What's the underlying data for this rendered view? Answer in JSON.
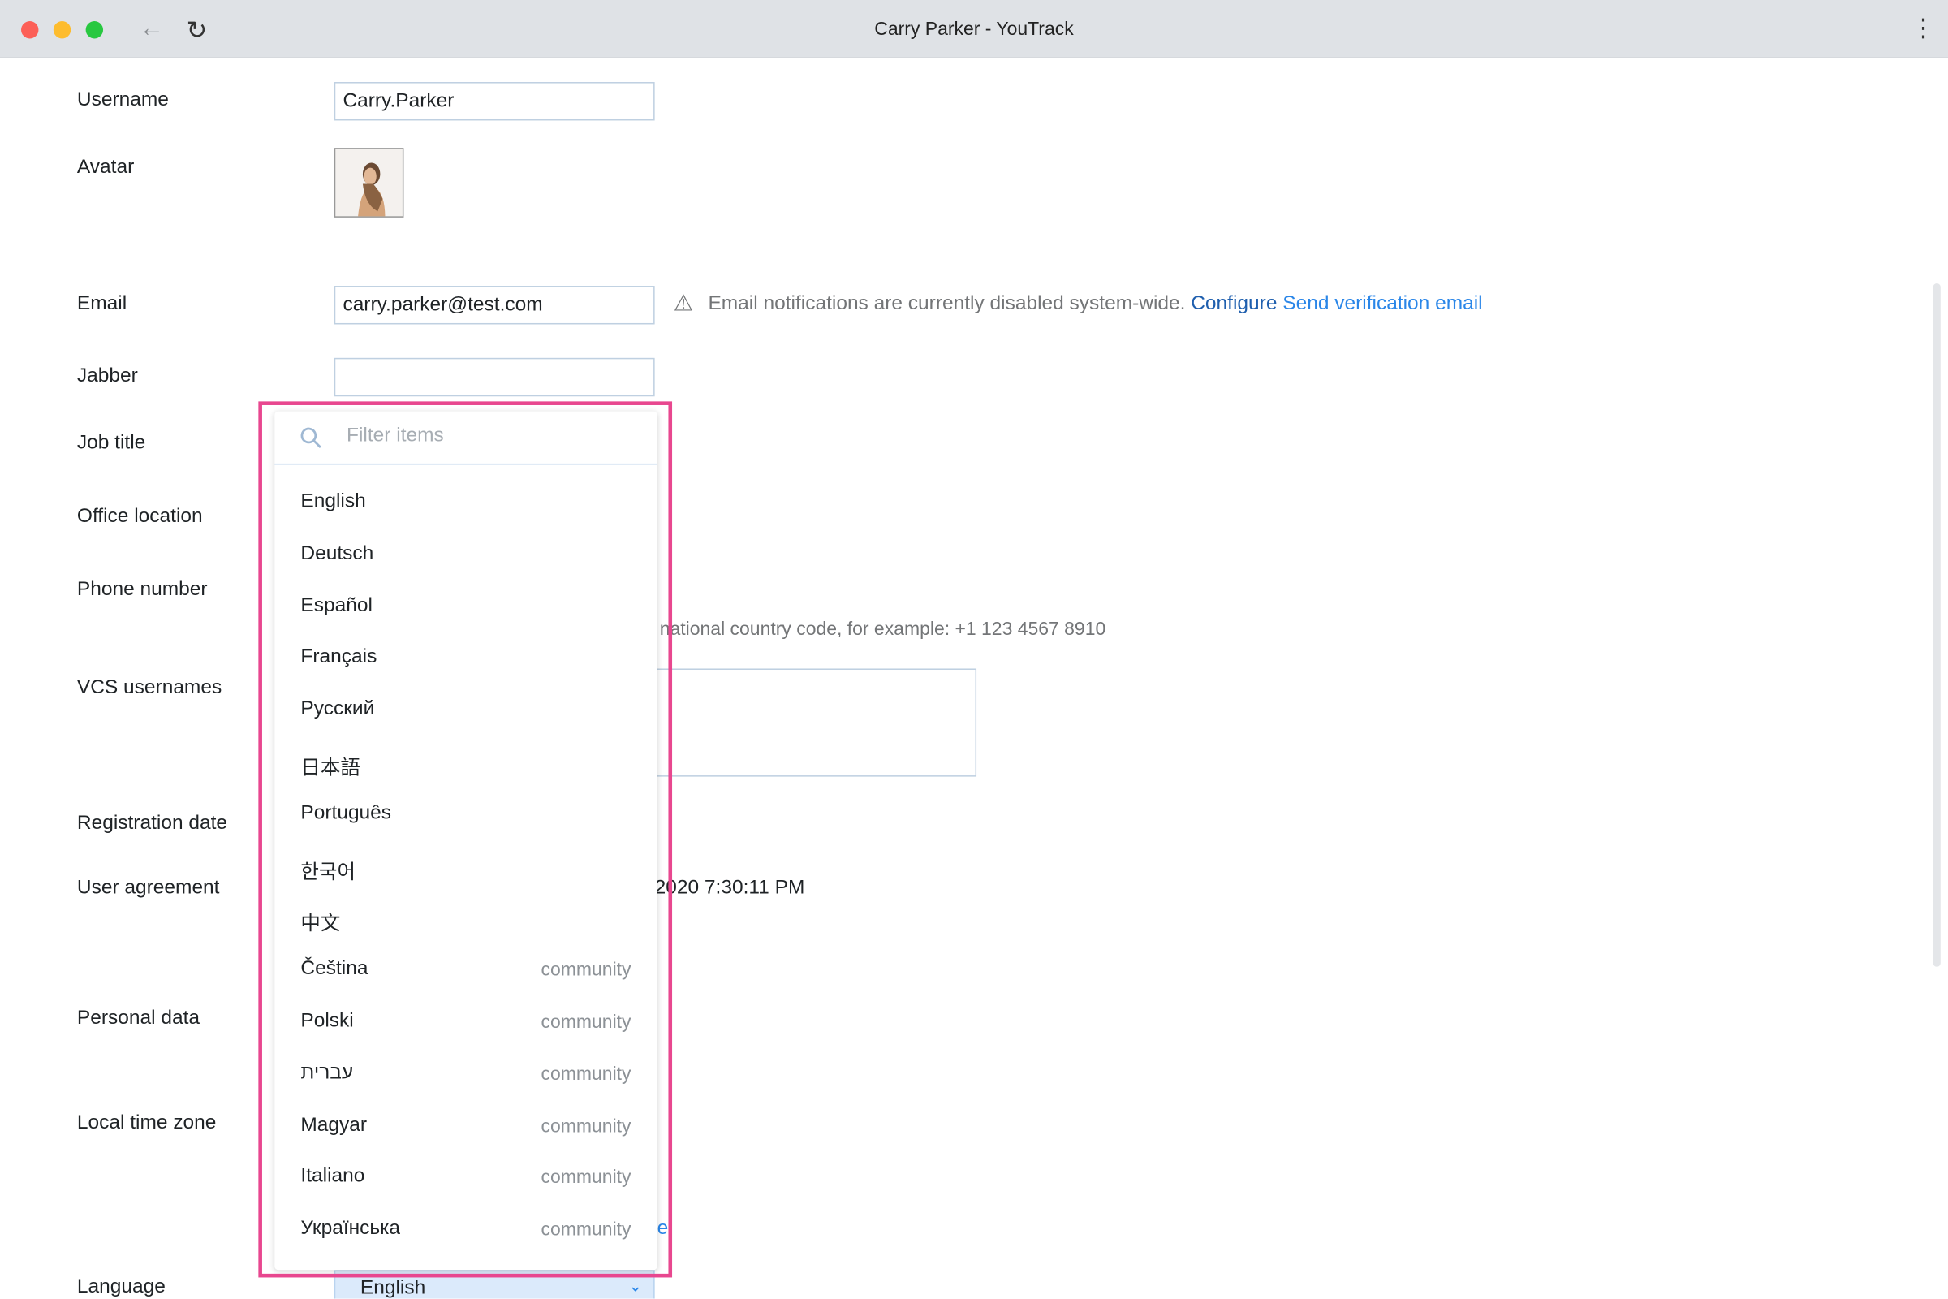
{
  "window": {
    "title": "Carry Parker - YouTrack"
  },
  "form": {
    "labels": {
      "username": "Username",
      "avatar": "Avatar",
      "email": "Email",
      "jabber": "Jabber",
      "job_title": "Job title",
      "office_location": "Office location",
      "phone_number": "Phone number",
      "vcs_usernames": "VCS usernames",
      "registration_date": "Registration date",
      "user_agreement": "User agreement",
      "personal_data": "Personal data",
      "local_time_zone": "Local time zone",
      "language": "Language"
    },
    "username": "Carry.Parker",
    "email": "carry.parker@test.com",
    "jabber": "",
    "email_warning": "Email notifications are currently disabled system-wide.",
    "configure_link": "Configure",
    "send_verification_link": "Send verification email",
    "phone_hint": "national country code, for example: +1 123 4567 8910",
    "user_agreement_value": "2020 7:30:11 PM",
    "partial_link": "e",
    "language": "English"
  },
  "dropdown": {
    "filter_placeholder": "Filter items",
    "items": [
      {
        "label": "English",
        "tag": ""
      },
      {
        "label": "Deutsch",
        "tag": ""
      },
      {
        "label": "Español",
        "tag": ""
      },
      {
        "label": "Français",
        "tag": ""
      },
      {
        "label": "Русский",
        "tag": ""
      },
      {
        "label": "日本語",
        "tag": ""
      },
      {
        "label": "Português",
        "tag": ""
      },
      {
        "label": "한국어",
        "tag": ""
      },
      {
        "label": "中文",
        "tag": ""
      },
      {
        "label": "Čeština",
        "tag": "community"
      },
      {
        "label": "Polski",
        "tag": "community"
      },
      {
        "label": "עברית",
        "tag": "community"
      },
      {
        "label": "Magyar",
        "tag": "community"
      },
      {
        "label": "Italiano",
        "tag": "community"
      },
      {
        "label": "Українська",
        "tag": "community"
      }
    ]
  },
  "colors": {
    "highlight": "#e8478f",
    "link": "#2a86e8",
    "link_dark": "#1f5fae",
    "select_bg": "#dbeafb"
  }
}
